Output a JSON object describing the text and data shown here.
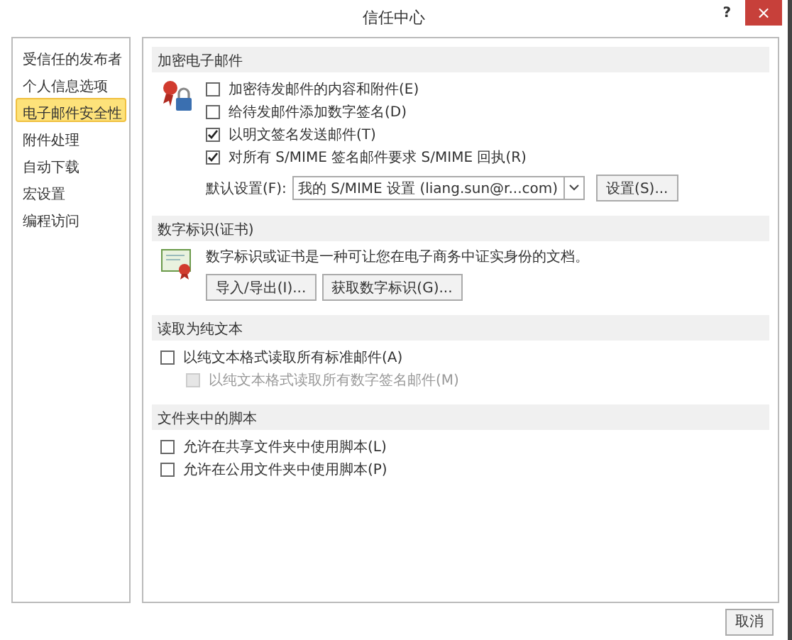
{
  "window": {
    "title": "信任中心",
    "help": "?",
    "close": "×"
  },
  "sidebar": {
    "items": [
      {
        "label": "受信任的发布者",
        "selected": false
      },
      {
        "label": "个人信息选项",
        "selected": false
      },
      {
        "label": "电子邮件安全性",
        "selected": true
      },
      {
        "label": "附件处理",
        "selected": false
      },
      {
        "label": "自动下载",
        "selected": false
      },
      {
        "label": "宏设置",
        "selected": false
      },
      {
        "label": "编程访问",
        "selected": false
      }
    ]
  },
  "sections": [
    {
      "title": "加密电子邮件",
      "kind": "lock",
      "options": [
        {
          "label": "加密待发邮件的内容和附件(E)",
          "checked": false,
          "disabled": false,
          "indent": false
        },
        {
          "label": "给待发邮件添加数字签名(D)",
          "checked": false,
          "disabled": false,
          "indent": false
        },
        {
          "label": "以明文签名发送邮件(T)",
          "checked": true,
          "disabled": false,
          "indent": false
        },
        {
          "label": "对所有 S/MIME 签名邮件要求 S/MIME 回执(R)",
          "checked": true,
          "disabled": false,
          "indent": false
        }
      ],
      "default_setting": {
        "label": "默认设置(F):",
        "value": "我的 S/MIME 设置 (liang.sun@r...com)",
        "button": "设置(S)..."
      }
    },
    {
      "title": "数字标识(证书)",
      "kind": "certificate",
      "description": "数字标识或证书是一种可让您在电子商务中证实身份的文档。",
      "buttons": [
        "导入/导出(I)...",
        "获取数字标识(G)..."
      ]
    },
    {
      "title": "读取为纯文本",
      "options": [
        {
          "label": "以纯文本格式读取所有标准邮件(A)",
          "checked": false,
          "disabled": false,
          "indent": false
        },
        {
          "label": "以纯文本格式读取所有数字签名邮件(M)",
          "checked": false,
          "disabled": true,
          "indent": true
        }
      ]
    },
    {
      "title": "文件夹中的脚本",
      "options": [
        {
          "label": "允许在共享文件夹中使用脚本(L)",
          "checked": false,
          "disabled": false,
          "indent": false
        },
        {
          "label": "允许在公用文件夹中使用脚本(P)",
          "checked": false,
          "disabled": false,
          "indent": false
        }
      ]
    }
  ],
  "footer": {
    "buttons": [
      "取消"
    ]
  }
}
